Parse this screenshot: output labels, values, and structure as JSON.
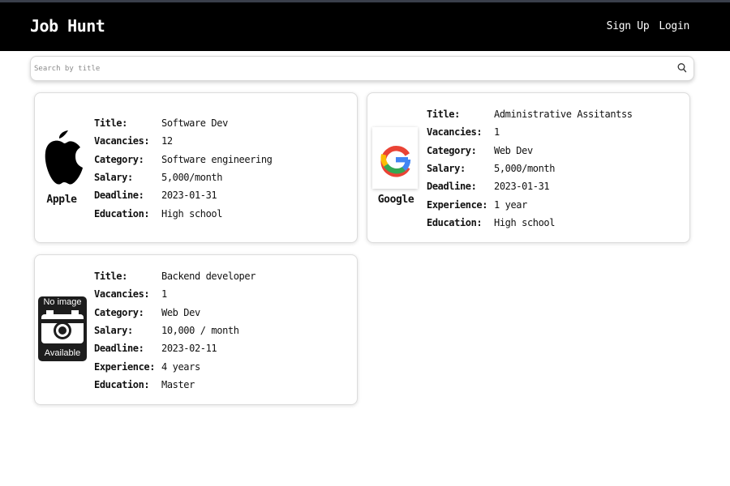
{
  "header": {
    "brand": "Job Hunt",
    "nav": {
      "signup": "Sign Up",
      "login": "Login"
    }
  },
  "search": {
    "placeholder": "Search by title",
    "value": "",
    "icon": "search-icon"
  },
  "jobs": [
    {
      "company": "Apple",
      "logo": "apple-logo",
      "fields": [
        {
          "label": "Title:",
          "value": "Software Dev"
        },
        {
          "label": "Vacancies:",
          "value": "12"
        },
        {
          "label": "Category:",
          "value": "Software engineering"
        },
        {
          "label": "Salary:",
          "value": "5,000/month"
        },
        {
          "label": "Deadline:",
          "value": "2023-01-31"
        },
        {
          "label": "Education:",
          "value": "High school"
        }
      ]
    },
    {
      "company": "Google",
      "logo": "google-logo",
      "fields": [
        {
          "label": "Title:",
          "value": "Administrative Assitantss"
        },
        {
          "label": "Vacancies:",
          "value": "1"
        },
        {
          "label": "Category:",
          "value": "Web Dev"
        },
        {
          "label": "Salary:",
          "value": "5,000/month"
        },
        {
          "label": "Deadline:",
          "value": "2023-01-31"
        },
        {
          "label": "Experience:",
          "value": "1 year"
        },
        {
          "label": "Education:",
          "value": "High school"
        }
      ]
    },
    {
      "company": "",
      "logo": "no-image-placeholder",
      "logo_text_top": "No image",
      "logo_text_bottom": "Available",
      "fields": [
        {
          "label": "Title:",
          "value": "Backend developer"
        },
        {
          "label": "Vacancies:",
          "value": "1"
        },
        {
          "label": "Category:",
          "value": "Web Dev"
        },
        {
          "label": "Salary:",
          "value": "10,000 / month"
        },
        {
          "label": "Deadline:",
          "value": "2023-02-11"
        },
        {
          "label": "Experience:",
          "value": "4 years"
        },
        {
          "label": "Education:",
          "value": "Master"
        }
      ]
    }
  ]
}
